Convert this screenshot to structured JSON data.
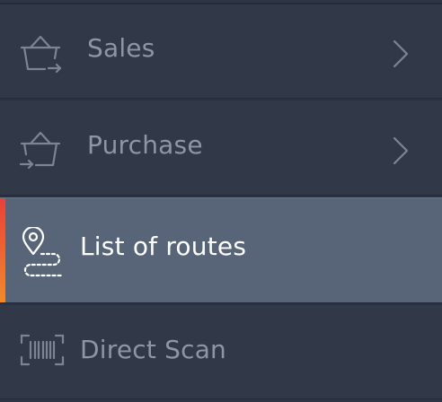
{
  "menu": {
    "items": [
      {
        "label": "Sales",
        "icon": "basket-out-icon",
        "has_submenu": true,
        "active": false
      },
      {
        "label": "Purchase",
        "icon": "basket-in-icon",
        "has_submenu": true,
        "active": false
      },
      {
        "label": "List of routes",
        "icon": "route-pin-icon",
        "has_submenu": false,
        "active": true
      },
      {
        "label": "Direct Scan",
        "icon": "barcode-scan-icon",
        "has_submenu": false,
        "active": false
      }
    ]
  },
  "colors": {
    "background": "#313949",
    "active_background": "#586579",
    "accent_start": "#e8413a",
    "accent_end": "#f08a2a",
    "text": "#8e96a4",
    "active_text": "#ffffff"
  }
}
